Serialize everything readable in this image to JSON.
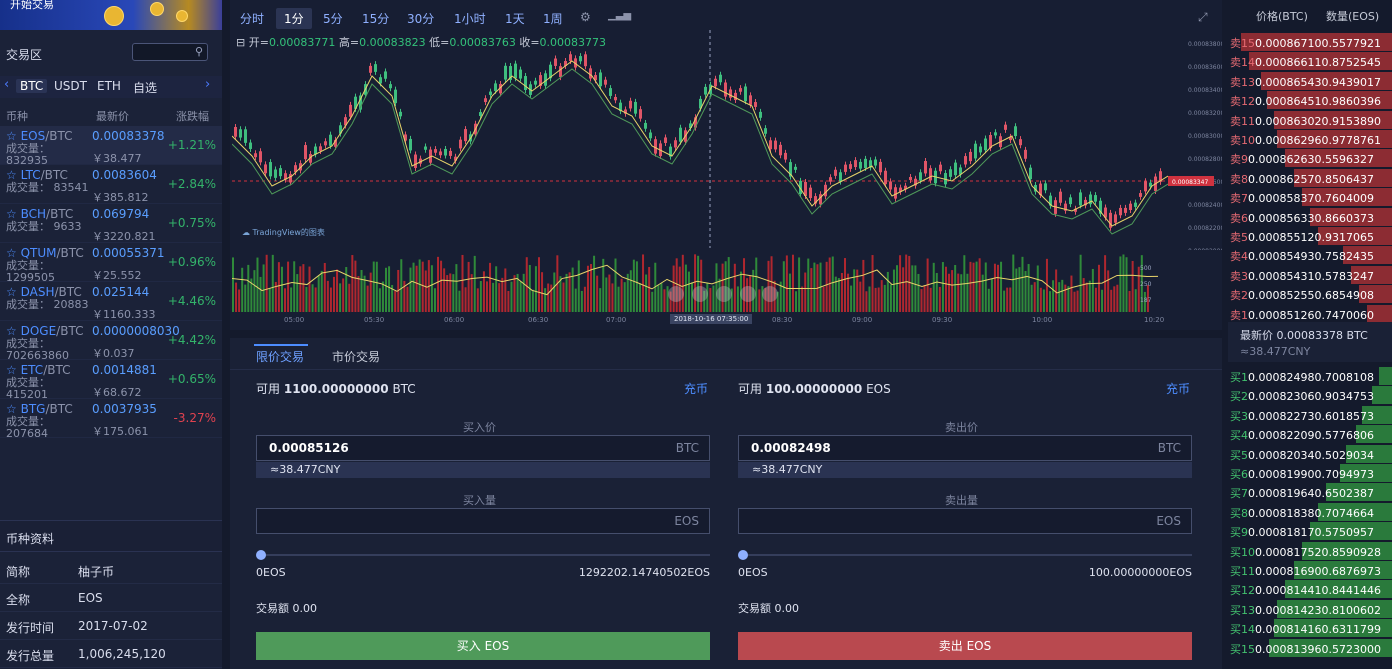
{
  "banner": {
    "text": "开始交易"
  },
  "market": {
    "title": "交易区",
    "tabs": [
      "BTC",
      "USDT",
      "ETH",
      "自选"
    ],
    "columns": {
      "coin": "币种",
      "price": "最新价",
      "change": "涨跌幅"
    },
    "volume_label": "成交量：",
    "rows": [
      {
        "coin": "EOS",
        "quote": "/BTC",
        "price": "0.00083378",
        "volume": "832935",
        "cny": "￥38.477",
        "change": "+1.21%",
        "dir": "up"
      },
      {
        "coin": "LTC",
        "quote": "/BTC",
        "price": "0.0083604",
        "volume": "83541",
        "cny": "￥385.812",
        "change": "+2.84%",
        "dir": "up"
      },
      {
        "coin": "BCH",
        "quote": "/BTC",
        "price": "0.069794",
        "volume": "9633",
        "cny": "￥3220.821",
        "change": "+0.75%",
        "dir": "up"
      },
      {
        "coin": "QTUM",
        "quote": "/BTC",
        "price": "0.00055371",
        "volume": "1299505",
        "cny": "￥25.552",
        "change": "+0.96%",
        "dir": "up"
      },
      {
        "coin": "DASH",
        "quote": "/BTC",
        "price": "0.025144",
        "volume": "20883",
        "cny": "￥1160.333",
        "change": "+4.46%",
        "dir": "up"
      },
      {
        "coin": "DOGE",
        "quote": "/BTC",
        "price": "0.0000008030",
        "volume": "702663860",
        "cny": "￥0.037",
        "change": "+4.42%",
        "dir": "up"
      },
      {
        "coin": "ETC",
        "quote": "/BTC",
        "price": "0.0014881",
        "volume": "415201",
        "cny": "￥68.672",
        "change": "+0.65%",
        "dir": "up"
      },
      {
        "coin": "BTG",
        "quote": "/BTC",
        "price": "0.0037935",
        "volume": "207684",
        "cny": "￥175.061",
        "change": "-3.27%",
        "dir": "dn"
      }
    ]
  },
  "coin_info": {
    "title": "币种资料",
    "rows": [
      {
        "k": "简称",
        "v": "柚子币"
      },
      {
        "k": "全称",
        "v": "EOS"
      },
      {
        "k": "发行时间",
        "v": "2017-07-02"
      },
      {
        "k": "发行总量",
        "v": "1,006,245,120"
      }
    ]
  },
  "chart": {
    "timeframes": [
      "分时",
      "1分",
      "5分",
      "15分",
      "30分",
      "1小时",
      "1天",
      "1周"
    ],
    "active_timeframe": "1分",
    "ohlc": {
      "open_label": "开=",
      "open": "0.00083771",
      "high_label": "高=",
      "high": "0.00083823",
      "low_label": "低=",
      "low": "0.00083763",
      "close_label": "收=",
      "close": "0.00083773"
    },
    "watermark": "TradingView的图表",
    "y_ticks": [
      "0.00083800",
      "0.00083600",
      "0.00083400",
      "0.00083200",
      "0.00083000",
      "0.00082800",
      "0.00082600",
      "0.00082400",
      "0.00082200",
      "0.00082000"
    ],
    "price_marker": "0.00083347",
    "vol_ticks": [
      "500",
      "250",
      "187"
    ],
    "x_ticks": [
      "05:00",
      "05:30",
      "06:00",
      "06:30",
      "07:00",
      "08:00",
      "08:30",
      "09:00",
      "09:30",
      "10:00",
      "10:20"
    ],
    "crosshair_time": "2018-10-16 07:35:00"
  },
  "trade": {
    "tabs": [
      "限价交易",
      "市价交易"
    ],
    "buy": {
      "avail_label": "可用",
      "avail": "1100.00000000",
      "avail_unit": "BTC",
      "recharge": "充币",
      "price_label": "买入价",
      "price": "0.00085126",
      "price_unit": "BTC",
      "cny": "≈38.477CNY",
      "amount_label": "买入量",
      "amount_unit": "EOS",
      "min": "0EOS",
      "max": "1292202.14740502EOS",
      "total_label": "交易额",
      "total": "0.00",
      "button": "买入 EOS"
    },
    "sell": {
      "avail_label": "可用",
      "avail": "100.00000000",
      "avail_unit": "EOS",
      "recharge": "充币",
      "price_label": "卖出价",
      "price": "0.00082498",
      "price_unit": "BTC",
      "cny": "≈38.477CNY",
      "amount_label": "卖出量",
      "amount_unit": "EOS",
      "min": "0EOS",
      "max": "100.00000000EOS",
      "total_label": "交易额",
      "total": "0.00",
      "button": "卖出 EOS"
    }
  },
  "orderbook": {
    "header": {
      "price": "价格(BTC)",
      "amount": "数量(EOS)"
    },
    "asks": [
      {
        "label": "卖15",
        "price": "0.00086710",
        "amount": "0.5577921",
        "depth": 0.92
      },
      {
        "label": "卖14",
        "price": "0.00086611",
        "amount": "0.8752545",
        "depth": 0.87
      },
      {
        "label": "卖13",
        "price": "0.00086543",
        "amount": "0.9439017",
        "depth": 0.8
      },
      {
        "label": "卖12",
        "price": "0.00086451",
        "amount": "0.9860396",
        "depth": 0.76
      },
      {
        "label": "卖11",
        "price": "0.00086302",
        "amount": "0.9153890",
        "depth": 0.72
      },
      {
        "label": "卖10",
        "price": "0.00086296",
        "amount": "0.9778761",
        "depth": 0.7
      },
      {
        "label": "卖9",
        "price": "0.00086263",
        "amount": "0.5596327",
        "depth": 0.65
      },
      {
        "label": "卖8",
        "price": "0.00086257",
        "amount": "0.8506437",
        "depth": 0.6
      },
      {
        "label": "卖7",
        "price": "0.00085837",
        "amount": "0.7604009",
        "depth": 0.55
      },
      {
        "label": "卖6",
        "price": "0.00085633",
        "amount": "0.8660373",
        "depth": 0.5
      },
      {
        "label": "卖5",
        "price": "0.00085512",
        "amount": "0.9317065",
        "depth": 0.45
      },
      {
        "label": "卖4",
        "price": "0.00085493",
        "amount": "0.7582435",
        "depth": 0.3
      },
      {
        "label": "卖3",
        "price": "0.00085431",
        "amount": "0.5783247",
        "depth": 0.25
      },
      {
        "label": "卖2",
        "price": "0.00085255",
        "amount": "0.6854908",
        "depth": 0.2
      },
      {
        "label": "卖1",
        "price": "0.00085126",
        "amount": "0.7470060",
        "depth": 0.15
      }
    ],
    "last_label": "最新价",
    "last": "0.00083378 BTC",
    "last_cny": "≈38.477CNY",
    "bids": [
      {
        "label": "买1",
        "price": "0.00082498",
        "amount": "0.7008108",
        "depth": 0.08
      },
      {
        "label": "买2",
        "price": "0.00082306",
        "amount": "0.9034753",
        "depth": 0.12
      },
      {
        "label": "买3",
        "price": "0.00082273",
        "amount": "0.6018573",
        "depth": 0.18
      },
      {
        "label": "买4",
        "price": "0.00082209",
        "amount": "0.5776806",
        "depth": 0.22
      },
      {
        "label": "买5",
        "price": "0.00082034",
        "amount": "0.5029034",
        "depth": 0.28
      },
      {
        "label": "买6",
        "price": "0.00081990",
        "amount": "0.7094973",
        "depth": 0.32
      },
      {
        "label": "买7",
        "price": "0.00081964",
        "amount": "0.6502387",
        "depth": 0.4
      },
      {
        "label": "买8",
        "price": "0.00081838",
        "amount": "0.7074664",
        "depth": 0.45
      },
      {
        "label": "买9",
        "price": "0.00081817",
        "amount": "0.5750957",
        "depth": 0.5
      },
      {
        "label": "买10",
        "price": "0.00081752",
        "amount": "0.8590928",
        "depth": 0.55
      },
      {
        "label": "买11",
        "price": "0.00081690",
        "amount": "0.6876973",
        "depth": 0.6
      },
      {
        "label": "买12",
        "price": "0.00081441",
        "amount": "0.8441446",
        "depth": 0.65
      },
      {
        "label": "买13",
        "price": "0.00081423",
        "amount": "0.8100602",
        "depth": 0.7
      },
      {
        "label": "买14",
        "price": "0.00081416",
        "amount": "0.6311799",
        "depth": 0.72
      },
      {
        "label": "买15",
        "price": "0.00081396",
        "amount": "0.5723000",
        "depth": 0.75
      }
    ]
  },
  "colors": {
    "up": "#33b36a",
    "down": "#e0424f",
    "accent": "#4d8dff",
    "bg": "#141a2c"
  }
}
